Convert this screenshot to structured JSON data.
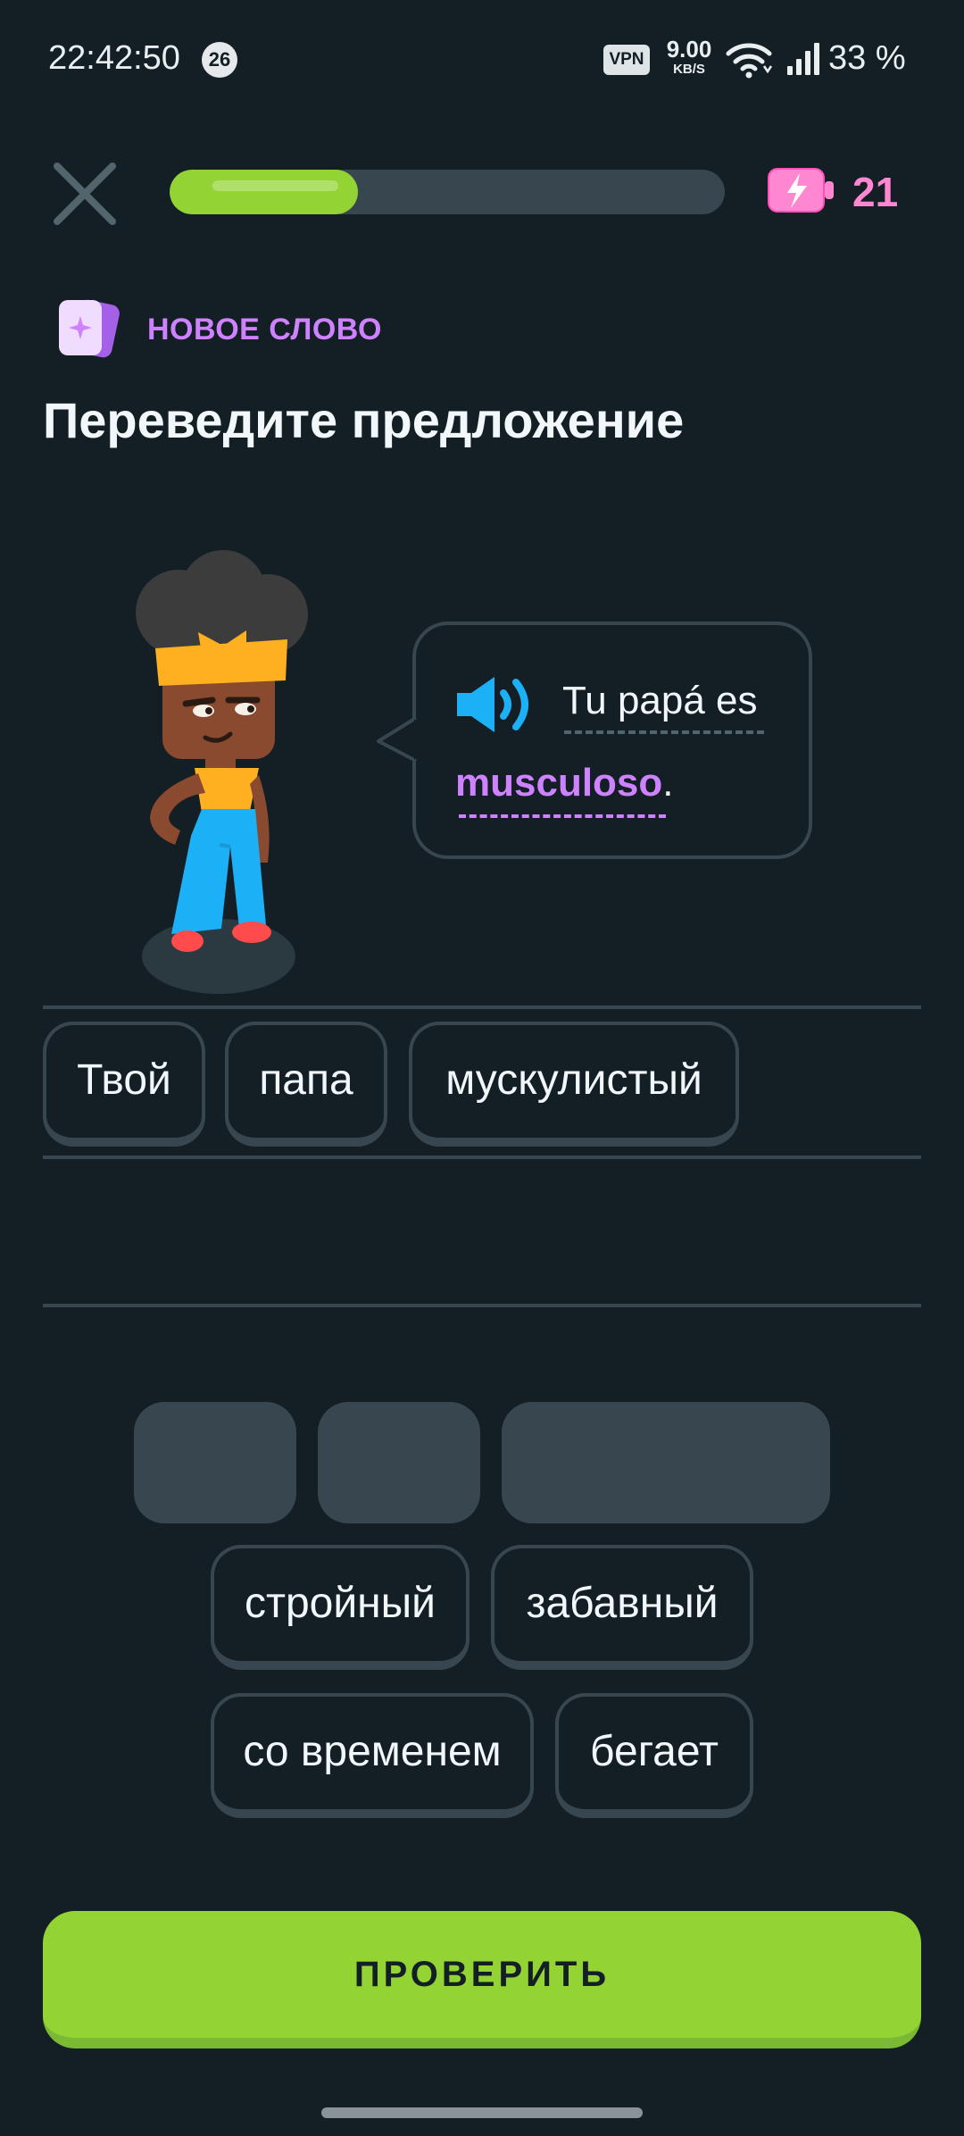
{
  "status_bar": {
    "time": "22:42:50",
    "notification_count": "26",
    "vpn": "VPN",
    "speed_value": "9.00",
    "speed_unit": "KB/S",
    "battery_percent": "33 %"
  },
  "top_bar": {
    "progress": 0.34,
    "energy_count": "21"
  },
  "lesson": {
    "label": "НОВОЕ СЛОВО",
    "title": "Переведите предложение",
    "sentence_part1": "Tu papá es",
    "new_word": "musculoso",
    "sentence_end": "."
  },
  "answer_tiles": [
    "Твой",
    "папа",
    "мускулистый"
  ],
  "word_bank": [
    "стройный",
    "забавный",
    "со временем",
    "бегает"
  ],
  "check_button": "ПРОВЕРИТЬ",
  "colors": {
    "background": "#131f24",
    "accent_green": "#93d333",
    "purple": "#ce82ff",
    "pink": "#ff86d0",
    "blue": "#1cb0f6",
    "border": "#37464f"
  }
}
